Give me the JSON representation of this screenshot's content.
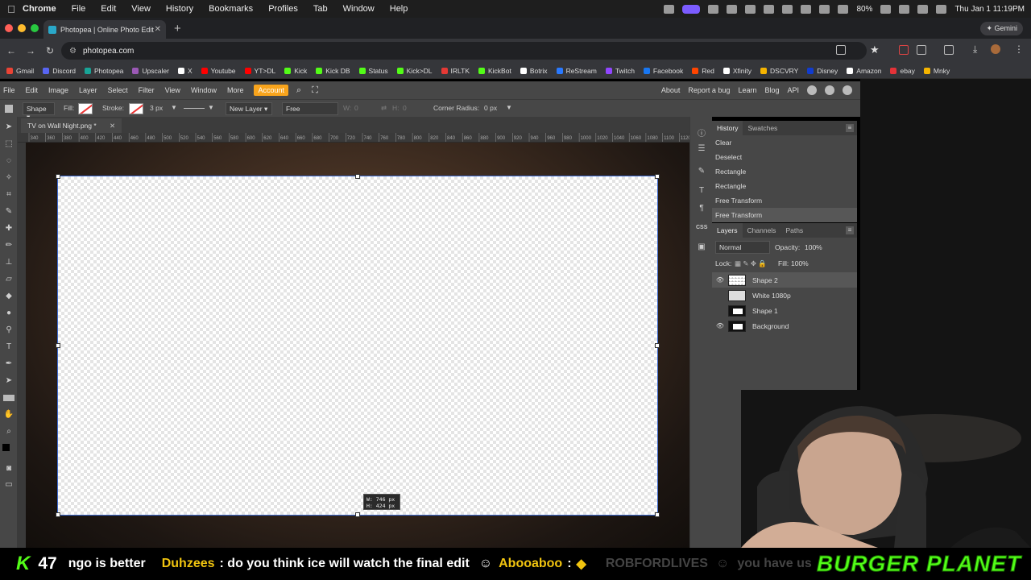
{
  "macos": {
    "menu": [
      "Chrome",
      "File",
      "Edit",
      "View",
      "History",
      "Bookmarks",
      "Profiles",
      "Tab",
      "Window",
      "Help"
    ],
    "battery": "80%",
    "clock": "Thu Jan 1  11:19PM"
  },
  "chrome": {
    "tab_title": "Photopea | Online Photo Edit",
    "url": "photopea.com",
    "gemini_label": "Gemini",
    "bookmarks": [
      {
        "label": "Gmail",
        "color": "#ea4335"
      },
      {
        "label": "Discord",
        "color": "#5865f2"
      },
      {
        "label": "Photopea",
        "color": "#18a497"
      },
      {
        "label": "Upscaler",
        "color": "#9b59b6"
      },
      {
        "label": "X",
        "color": "#ffffff"
      },
      {
        "label": "Youtube",
        "color": "#ff0000"
      },
      {
        "label": "YT>DL",
        "color": "#ff0000"
      },
      {
        "label": "Kick",
        "color": "#53fc18"
      },
      {
        "label": "Kick DB",
        "color": "#53fc18"
      },
      {
        "label": "Status",
        "color": "#53fc18"
      },
      {
        "label": "Kick>DL",
        "color": "#53fc18"
      },
      {
        "label": "IRLTK",
        "color": "#e53935"
      },
      {
        "label": "KickBot",
        "color": "#53fc18"
      },
      {
        "label": "Botrix",
        "color": "#ffffff"
      },
      {
        "label": "ReStream",
        "color": "#2979ff"
      },
      {
        "label": "Twitch",
        "color": "#9146ff"
      },
      {
        "label": "Facebook",
        "color": "#1877f2"
      },
      {
        "label": "Red",
        "color": "#ff4500"
      },
      {
        "label": "Xfinity",
        "color": "#ffffff"
      },
      {
        "label": "DSCVRY",
        "color": "#f5b400"
      },
      {
        "label": "Disney",
        "color": "#113ccf"
      },
      {
        "label": "Amazon",
        "color": "#ffffff"
      },
      {
        "label": "ebay",
        "color": "#e53238"
      },
      {
        "label": "Mnky",
        "color": "#f5b400"
      }
    ]
  },
  "photopea": {
    "menu": [
      "File",
      "Edit",
      "Image",
      "Layer",
      "Select",
      "Filter",
      "View",
      "Window",
      "More"
    ],
    "account_label": "Account",
    "right_links": [
      "About",
      "Report a bug",
      "Learn",
      "Blog",
      "API"
    ],
    "options": {
      "shape_label": "Shape",
      "fill_label": "Fill:",
      "stroke_label": "Stroke:",
      "stroke_size": "3 px",
      "new_layer": "New Layer",
      "mode": "Free",
      "w_label": "W:",
      "w_value": "0",
      "h_label": "H:",
      "h_value": "0",
      "corner_label": "Corner Radius:",
      "corner_value": "0 px"
    },
    "document_tab": "TV on Wall Night.png *",
    "ruler_labels": [
      "340",
      "360",
      "380",
      "400",
      "420",
      "440",
      "460",
      "480",
      "500",
      "520",
      "540",
      "560",
      "580",
      "600",
      "620",
      "640",
      "660",
      "680",
      "700",
      "720",
      "740",
      "760",
      "780",
      "800",
      "820",
      "840",
      "860",
      "880",
      "900",
      "920",
      "940",
      "960",
      "980",
      "1000",
      "1020",
      "1040",
      "1060",
      "1080",
      "1100",
      "1120"
    ],
    "tooltip": {
      "w": "W: 746 px",
      "h": "H: 424 px"
    },
    "history": {
      "tabs": [
        "History",
        "Swatches"
      ],
      "items": [
        "Clear",
        "Deselect",
        "Rectangle",
        "Rectangle",
        "Free Transform",
        "Free Transform"
      ]
    },
    "layers": {
      "tabs": [
        "Layers",
        "Channels",
        "Paths"
      ],
      "blend_mode": "Normal",
      "opacity_label": "Opacity:",
      "opacity": "100%",
      "lock_label": "Lock:",
      "fill_label": "Fill:",
      "fill": "100%",
      "items": [
        {
          "name": "Shape 2",
          "visible": true
        },
        {
          "name": "White 1080p",
          "visible": false
        },
        {
          "name": "Shape 1",
          "visible": false
        },
        {
          "name": "Background",
          "visible": true
        }
      ]
    }
  },
  "ticker": {
    "count": "47",
    "fragment": "ngo is better",
    "user1": "Duhzees",
    "msg1": ": do you think ice will watch the final edit",
    "user2": "Abooaboo",
    "sep": ":",
    "faded_user": "ROBFORDLIVES",
    "faded_msg": "you have us",
    "brand": "BURGER PLANET"
  }
}
